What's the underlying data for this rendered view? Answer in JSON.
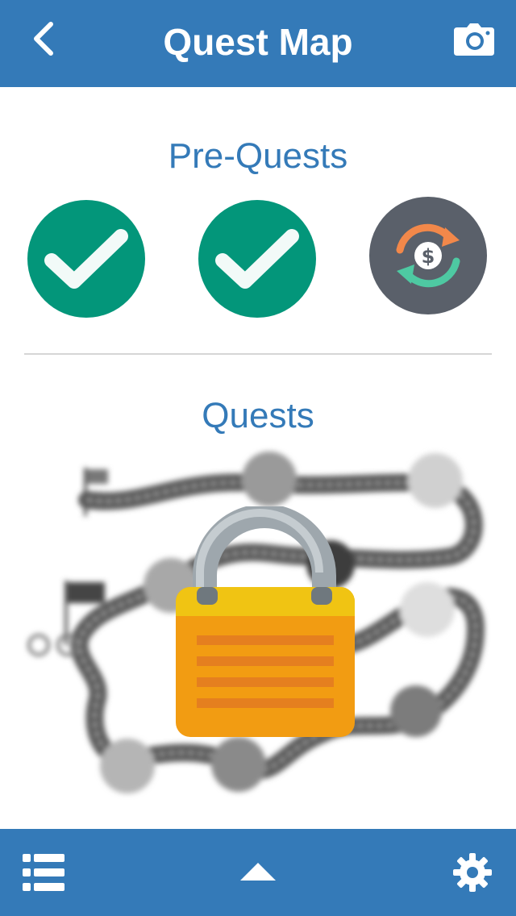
{
  "header": {
    "title": "Quest Map",
    "back_icon": "chevron-left-icon",
    "camera_icon": "camera-icon"
  },
  "pre_quests": {
    "title": "Pre-Quests",
    "items": [
      {
        "status": "completed",
        "icon": "checkmark-icon"
      },
      {
        "status": "completed",
        "icon": "checkmark-icon"
      },
      {
        "status": "current",
        "icon": "dollar-exchange-icon"
      }
    ]
  },
  "quests": {
    "title": "Quests",
    "locked": true,
    "lock_icon": "padlock-icon"
  },
  "footer": {
    "list_icon": "list-icon",
    "up_icon": "chevron-up-icon",
    "settings_icon": "gear-icon"
  },
  "colors": {
    "primary": "#347ab8",
    "completed": "#03967a",
    "current": "#5a606a",
    "lock_body": "#f29c12",
    "lock_top": "#f0c413"
  }
}
